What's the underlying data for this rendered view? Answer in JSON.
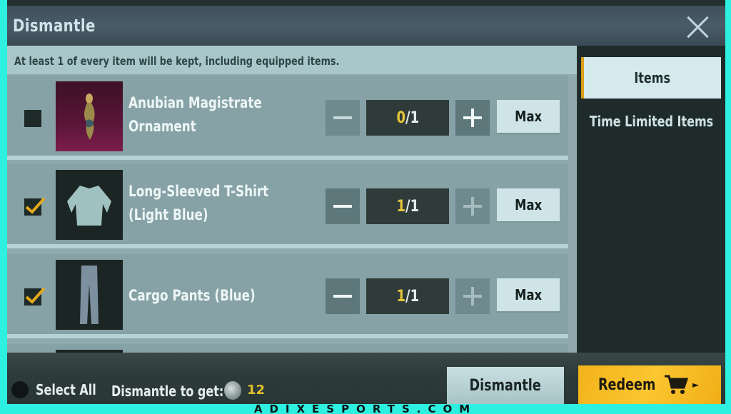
{
  "window": {
    "title": "Dismantle",
    "close_icon": "close-x-icon"
  },
  "notice": "At least 1 of every item will be kept, including equipped items.",
  "items": [
    {
      "name_line1": "Anubian Magistrate",
      "name_line2": "Ornament",
      "checked": false,
      "selected": "0",
      "total": "1",
      "max_label": "Max",
      "thumbnail": "ornament-icon"
    },
    {
      "name_line1": "Long-Sleeved T-Shirt",
      "name_line2": "(Light Blue)",
      "checked": true,
      "selected": "1",
      "total": "1",
      "max_label": "Max",
      "thumbnail": "tshirt-icon"
    },
    {
      "name_line1": "Cargo Pants (Blue)",
      "name_line2": "",
      "checked": true,
      "selected": "1",
      "total": "1",
      "max_label": "Max",
      "thumbnail": "pants-icon"
    }
  ],
  "tabs": [
    {
      "label": "Items",
      "active": true
    },
    {
      "label": "Time Limited Items",
      "active": false
    }
  ],
  "footer": {
    "select_all_label": "Select All",
    "dismantle_to_get_label": "Dismantle to get:",
    "reward_count": "12",
    "dismantle_button": "Dismantle",
    "redeem_button": "Redeem"
  },
  "colors": {
    "accent_yellow": "#f2b21a",
    "count_highlight": "#e7c43a",
    "border_cyan": "#2ef0e0"
  },
  "watermark": "ADIXESPORTS.COM"
}
